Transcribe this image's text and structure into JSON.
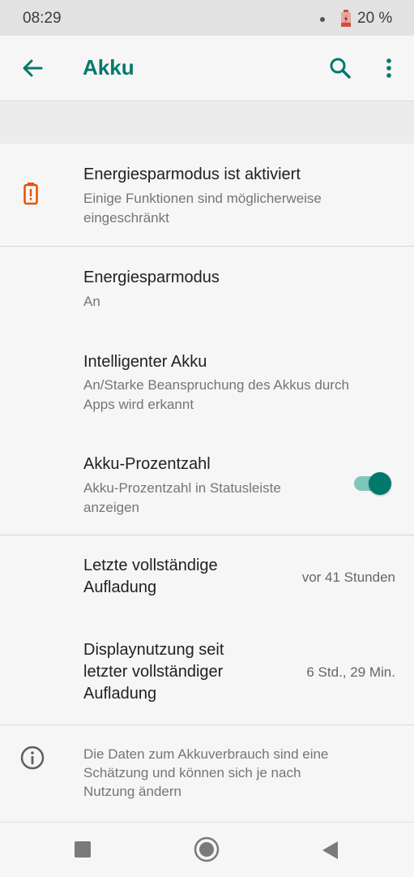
{
  "status_bar": {
    "time": "08:29",
    "battery_percent": "20 %"
  },
  "app_bar": {
    "title": "Akku"
  },
  "colors": {
    "accent": "#00796b",
    "warning": "#e65100",
    "toggle_track": "#80c6bd"
  },
  "saver_banner": {
    "title": "Energiesparmodus ist aktiviert",
    "summary_line1": "Einige Funktionen sind möglicherweise",
    "summary_line2": "eingeschränkt",
    "icon": "battery-alert-icon"
  },
  "settings": {
    "energy_saver": {
      "title": "Energiesparmodus",
      "summary": "An"
    },
    "smart_battery": {
      "title": "Intelligenter Akku",
      "summary_line1": "An/Starke Beanspruchung des Akkus durch",
      "summary_line2": "Apps wird erkannt"
    },
    "battery_percentage": {
      "title": "Akku-Prozentzahl",
      "summary_line1": "Akku-Prozentzahl in Statusleiste",
      "summary_line2": "anzeigen",
      "toggle_on": true
    }
  },
  "info": {
    "last_charge": {
      "title_line1": "Letzte vollständige",
      "title_line2": "Aufladung",
      "value": "vor 41 Stunden"
    },
    "screen_usage": {
      "title_line1": "Displaynutzung seit",
      "title_line2": "letzter vollständiger",
      "title_line3": "Aufladung",
      "value": "6 Std., 29 Min."
    }
  },
  "footer": {
    "line1": "Die Daten zum Akkuverbrauch sind eine",
    "line2": "Schätzung und können sich je nach",
    "line3": "Nutzung ändern",
    "icon": "info-icon"
  },
  "nav_bar": {
    "icons": [
      "recents-icon",
      "home-icon",
      "back-icon"
    ]
  }
}
